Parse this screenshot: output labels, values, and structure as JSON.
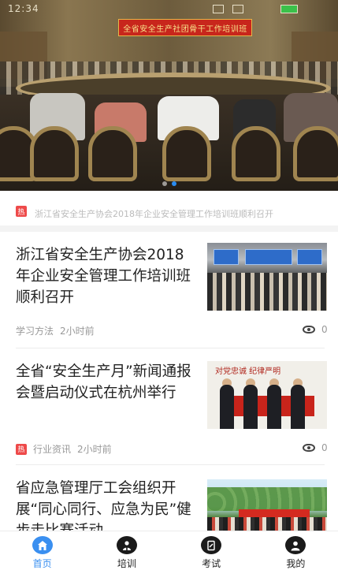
{
  "status_bar": {
    "time": "12:34"
  },
  "hero": {
    "banner_text": "全省安全生产社团骨干工作培训班",
    "slide_count": 2,
    "active_slide": 1
  },
  "ticker": {
    "badge": "热",
    "text": "浙江省安全生产协会2018年企业安全管理工作培训班顺利召开"
  },
  "news": [
    {
      "title": "浙江省安全生产协会2018年企业安全管理工作培训班顺利召开",
      "hot": false,
      "category": "学习方法",
      "time": "2小时前",
      "views": "0"
    },
    {
      "title": "全省“安全生产月”新闻通报会暨启动仪式在杭州举行",
      "hot": true,
      "hot_badge": "热",
      "category": "行业资讯",
      "time": "2小时前",
      "views": "0",
      "thumb_text": "对党忠诚 纪律严明"
    },
    {
      "title": "省应急管理厅工会组织开展“同心同行、应急为民”健步走比赛活动",
      "hot": false
    }
  ],
  "tabs": [
    {
      "label": "首页",
      "icon": "home-icon",
      "active": true
    },
    {
      "label": "培训",
      "icon": "training-icon",
      "active": false
    },
    {
      "label": "考试",
      "icon": "exam-icon",
      "active": false
    },
    {
      "label": "我的",
      "icon": "profile-icon",
      "active": false
    }
  ],
  "colors": {
    "accent": "#3a8ff0",
    "hot": "#ee4a4a"
  }
}
